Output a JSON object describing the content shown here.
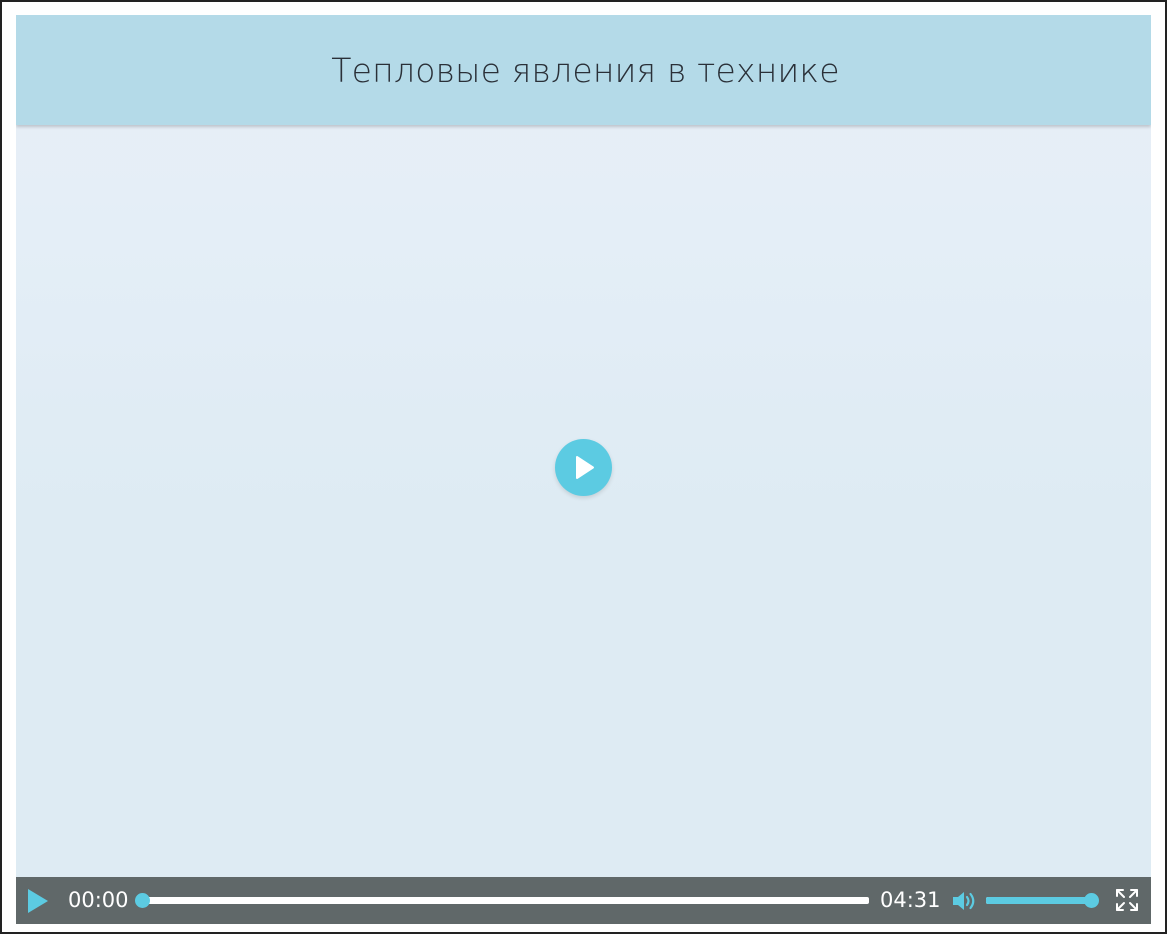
{
  "player": {
    "title": "Тепловые явления в технике",
    "controls": {
      "current_time": "00:00",
      "total_time": "04:31",
      "progress_fraction": 0,
      "volume_fraction": 1
    },
    "icons": {
      "big_play": "play-icon",
      "play": "play-icon",
      "volume": "volume-icon",
      "fullscreen": "fullscreen-icon"
    },
    "colors": {
      "accent": "#5ccbe2",
      "title_bar": "#b4dae8",
      "control_bar": "#606869"
    }
  }
}
